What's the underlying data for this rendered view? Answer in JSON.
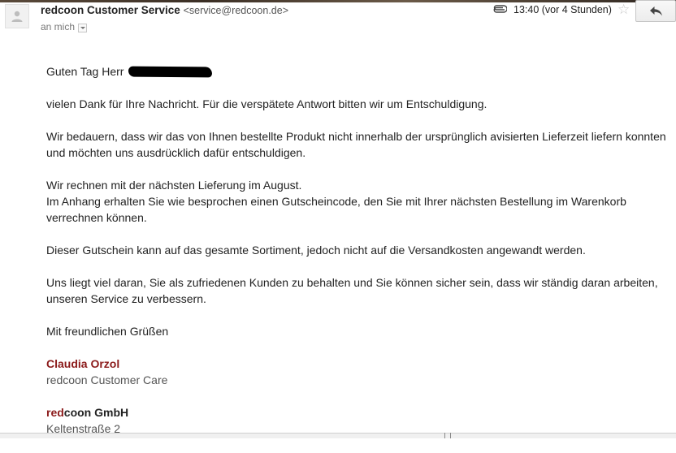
{
  "header": {
    "sender_name": "redcoon Customer Service",
    "sender_email": "<service@redcoon.de>",
    "recipient": "an mich",
    "timestamp": "13:40 (vor 4 Stunden)",
    "icons": {
      "avatar": "avatar-placeholder-icon",
      "attachment": "paperclip-icon",
      "star": "star-icon",
      "reply": "reply-arrow-icon",
      "recipient_details": "chevron-down-icon"
    }
  },
  "message": {
    "greeting": "Guten Tag Herr",
    "p1": "vielen Dank für Ihre Nachricht. Für die verspätete Antwort bitten wir um Entschuldigung.",
    "p2": "Wir bedauern, dass wir das von Ihnen bestellte Produkt nicht innerhalb der ursprünglich avisierten Lieferzeit liefern konnten und möchten uns ausdrücklich dafür entschuldigen.",
    "p3_line1": "Wir rechnen mit der nächsten Lieferung im August.",
    "p3_line2": "Im Anhang erhalten Sie wie besprochen einen Gutscheincode, den Sie mit Ihrer nächsten Bestellung im Warenkorb verrechnen können.",
    "p4": "Dieser Gutschein kann auf das gesamte Sortiment, jedoch nicht auf die Versandkosten angewandt werden.",
    "p5": "Uns liegt viel daran, Sie als zufriedenen Kunden zu behalten und Sie können sicher sein, dass wir ständig daran arbeiten, unseren Service zu verbessern.",
    "closing": "Mit freundlichen Grüßen"
  },
  "signature": {
    "name": "Claudia Orzol",
    "role": "redcoon Customer Care",
    "company_red": "red",
    "company_rest": "coon GmbH",
    "address_line1": "Keltenstraße 2"
  },
  "colors": {
    "signature_red": "#8b1a1a",
    "redaction": "#000000"
  }
}
